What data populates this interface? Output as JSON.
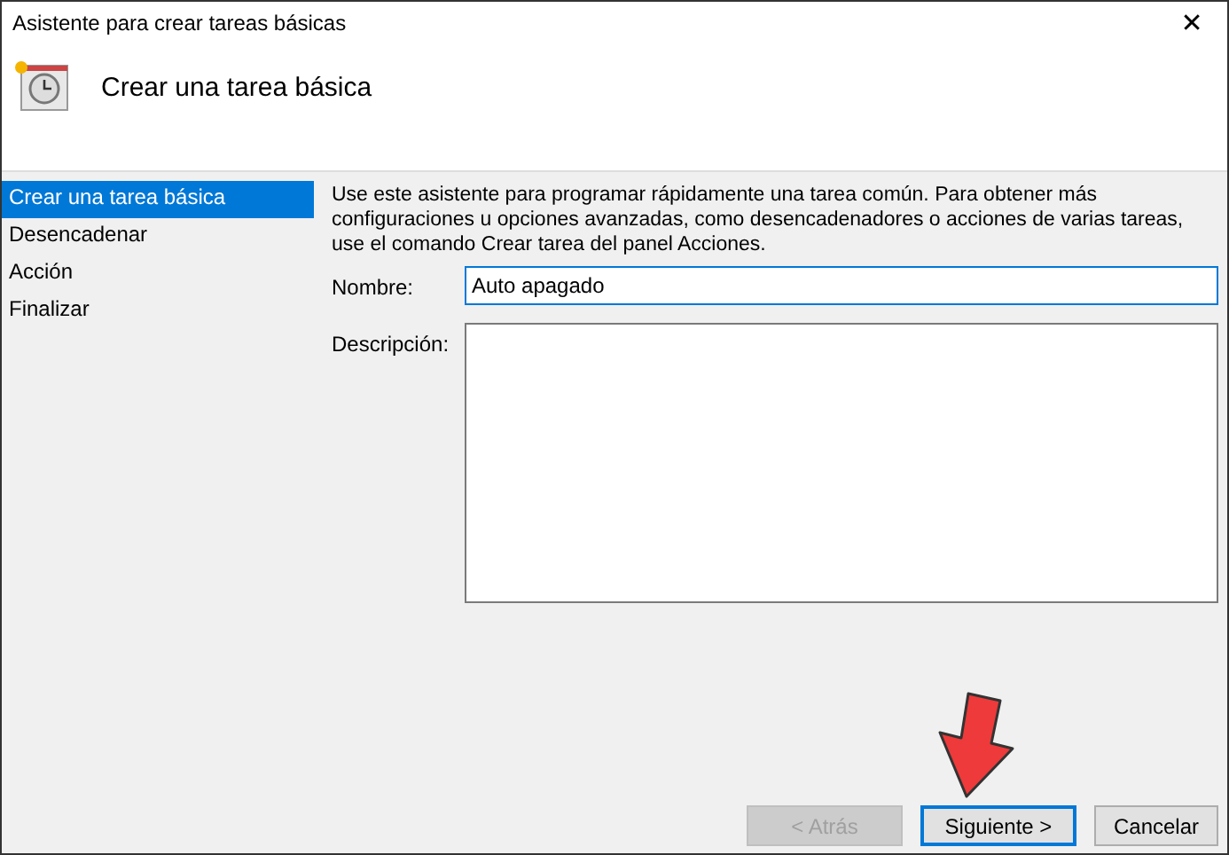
{
  "window": {
    "title": "Asistente para crear tareas básicas",
    "close": "✕"
  },
  "header": {
    "title": "Crear una tarea básica"
  },
  "sidebar": {
    "items": [
      {
        "label": "Crear una tarea básica",
        "selected": true
      },
      {
        "label": "Desencadenar",
        "selected": false
      },
      {
        "label": "Acción",
        "selected": false
      },
      {
        "label": "Finalizar",
        "selected": false
      }
    ]
  },
  "intro": "Use este asistente para programar rápidamente una tarea común. Para obtener más configuraciones u opciones avanzadas, como desencadenadores o acciones de varias tareas, use el comando Crear tarea del panel Acciones.",
  "form": {
    "name_label": "Nombre:",
    "name_value": "Auto apagado",
    "description_label": "Descripción:"
  },
  "buttons": [
    {
      "label": "< Atrás",
      "disabled": true,
      "default": false
    },
    {
      "label": "Siguiente >",
      "disabled": false,
      "default": true
    },
    {
      "label": "Cancelar",
      "disabled": false,
      "default": false
    }
  ]
}
